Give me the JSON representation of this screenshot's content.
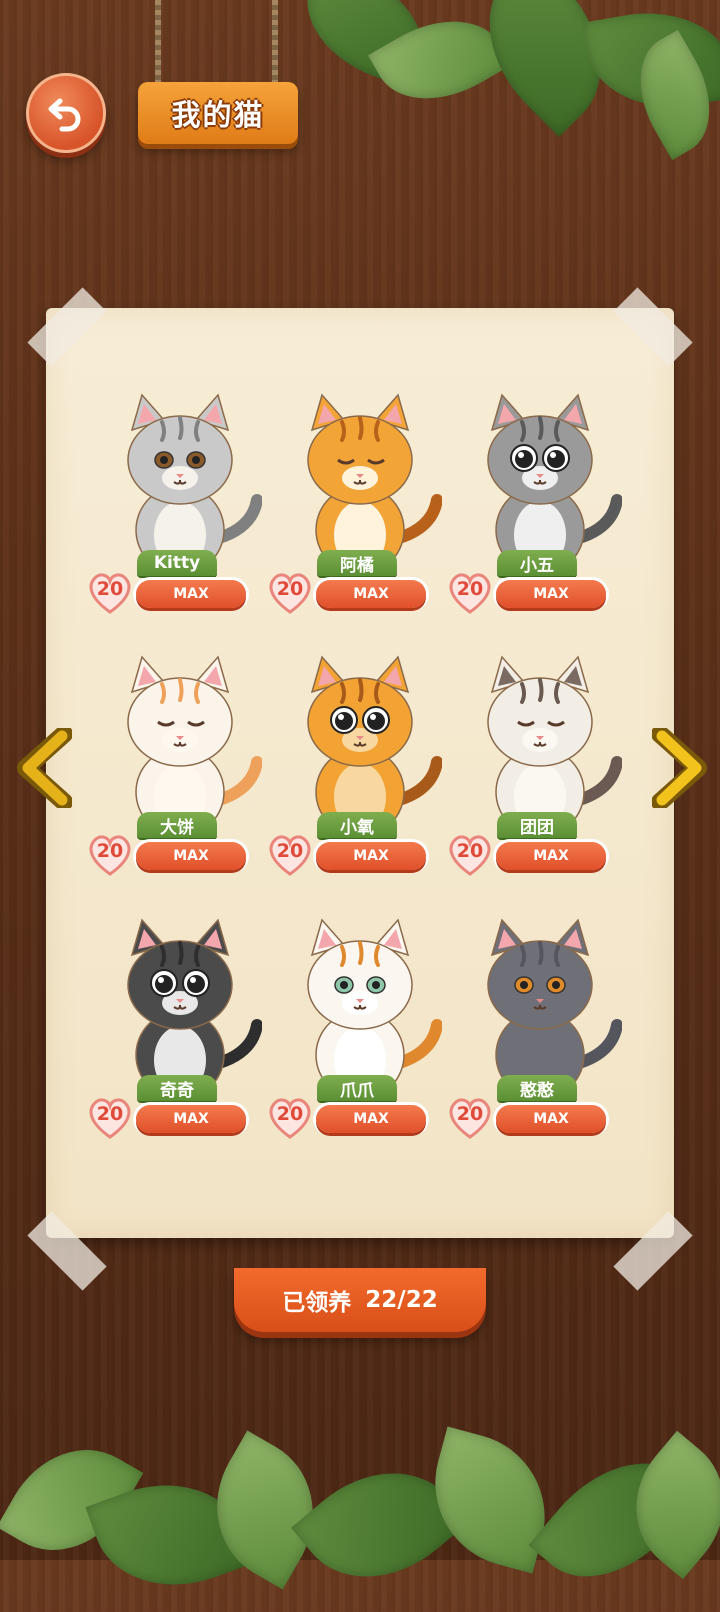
{
  "header": {
    "title": "我的猫"
  },
  "cats": [
    {
      "name": "Kitty",
      "level": "20",
      "status": "MAX",
      "fur": "#c9c9c9",
      "stripe": "#808080",
      "belly": "#f5f2ec",
      "ear": "#f4a6ad",
      "eyes": "brown"
    },
    {
      "name": "阿橘",
      "level": "20",
      "status": "MAX",
      "fur": "#f3a437",
      "stripe": "#b8611a",
      "belly": "#fff3dc",
      "ear": "#f4a6ad",
      "eyes": "closed"
    },
    {
      "name": "小五",
      "level": "20",
      "status": "MAX",
      "fur": "#9a9a9a",
      "stripe": "#5a5a5a",
      "belly": "#efefef",
      "ear": "#f4a6ad",
      "eyes": "big"
    },
    {
      "name": "大饼",
      "level": "20",
      "status": "MAX",
      "fur": "#fbf4ea",
      "stripe": "#eda15a",
      "belly": "#fff9f0",
      "ear": "#f4a6ad",
      "eyes": "closed"
    },
    {
      "name": "小氧",
      "level": "20",
      "status": "MAX",
      "fur": "#f2a334",
      "stripe": "#a85a1b",
      "belly": "#f8d7a0",
      "ear": "#f4a6ad",
      "eyes": "big"
    },
    {
      "name": "团团",
      "level": "20",
      "status": "MAX",
      "fur": "#f2eee6",
      "stripe": "#6b5a52",
      "belly": "#fbf8f2",
      "ear": "#7a6a62",
      "eyes": "closed"
    },
    {
      "name": "奇奇",
      "level": "20",
      "status": "MAX",
      "fur": "#4b4b4b",
      "stripe": "#2e2e2e",
      "belly": "#e8e8e8",
      "ear": "#f4a6ad",
      "eyes": "big"
    },
    {
      "name": "爪爪",
      "level": "20",
      "status": "MAX",
      "fur": "#fbf7f0",
      "stripe": "#e0882e",
      "belly": "#ffffff",
      "ear": "#f4a6ad",
      "eyes": "green"
    },
    {
      "name": "憨憨",
      "level": "20",
      "status": "MAX",
      "fur": "#6f6f78",
      "stripe": "#55555d",
      "belly": "#6f6f78",
      "ear": "#f4a6ad",
      "eyes": "orange"
    }
  ],
  "footer": {
    "label": "已领养",
    "count": "22/22"
  },
  "colors": {
    "wood": "#5a2f18",
    "paper": "#f7edd6",
    "accent": "#e0502a",
    "tag": "#6a9e40"
  }
}
